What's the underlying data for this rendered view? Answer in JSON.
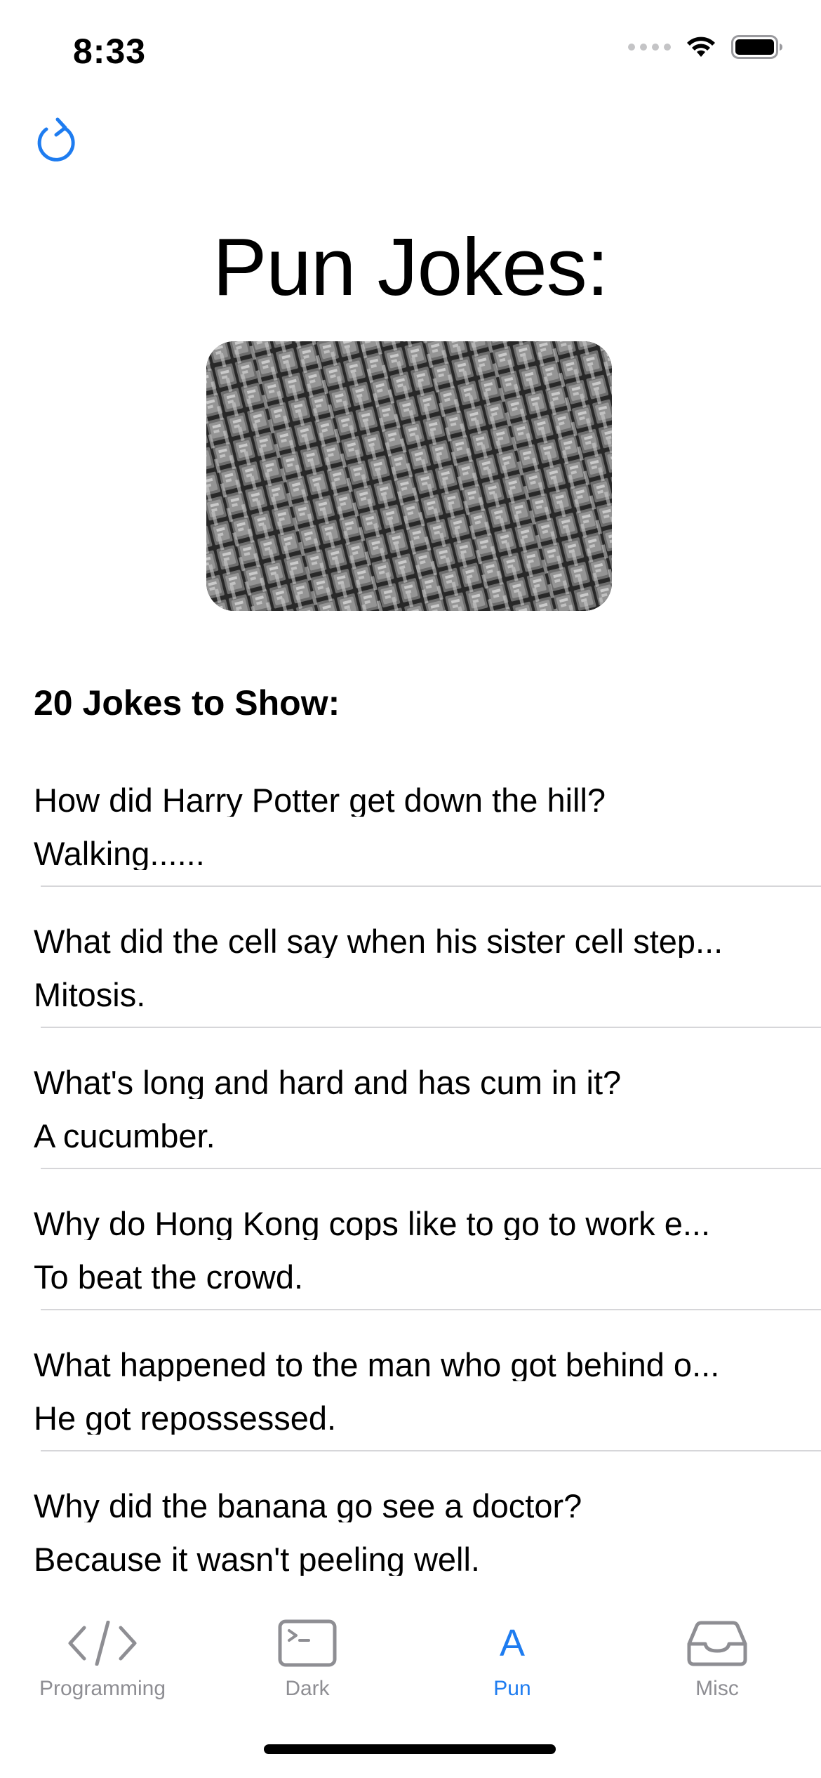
{
  "status_bar": {
    "time": "8:33"
  },
  "colors": {
    "accent": "#1e7cf0",
    "inactive_tab": "#8e8e93",
    "divider": "#d6d6d9"
  },
  "header": {
    "refresh_icon": "arrow-clockwise-icon",
    "title": "Pun Jokes:"
  },
  "section": {
    "title": "20 Jokes to Show:"
  },
  "jokes": [
    {
      "setup": "How did Harry Potter get down the hill?",
      "punchline": "Walking......"
    },
    {
      "setup": "What did the cell say when his sister cell step...",
      "punchline": "Mitosis."
    },
    {
      "setup": "What's long and hard and has cum in it?",
      "punchline": "A cucumber."
    },
    {
      "setup": "Why do Hong Kong cops like to go to work e...",
      "punchline": "To beat the crowd."
    },
    {
      "setup": "What happened to the man who got behind o...",
      "punchline": "He got repossessed."
    },
    {
      "setup": "Why did the banana go see a doctor?",
      "punchline": "Because it wasn't peeling well."
    }
  ],
  "tabs": [
    {
      "label": "Programming",
      "icon": "code-brackets-icon",
      "active": false
    },
    {
      "label": "Dark",
      "icon": "terminal-icon",
      "active": false
    },
    {
      "label": "Pun",
      "icon": "letter-a-icon",
      "glyph": "A",
      "active": true
    },
    {
      "label": "Misc",
      "icon": "tray-icon",
      "active": false
    }
  ]
}
